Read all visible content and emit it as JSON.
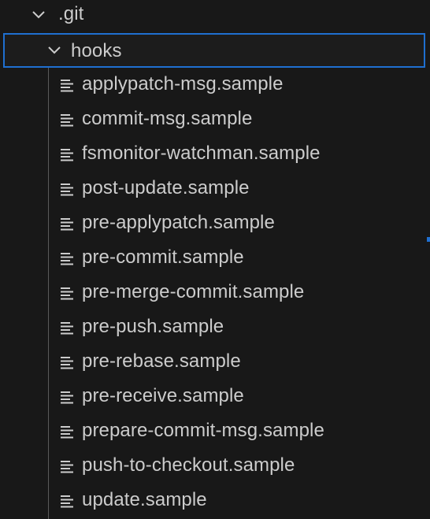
{
  "explorer": {
    "root_folder": {
      "label": ".git",
      "expanded": true
    },
    "sub_folder": {
      "label": "hooks",
      "expanded": true,
      "selected": true
    },
    "files": [
      {
        "label": "applypatch-msg.sample"
      },
      {
        "label": "commit-msg.sample"
      },
      {
        "label": "fsmonitor-watchman.sample"
      },
      {
        "label": "post-update.sample"
      },
      {
        "label": "pre-applypatch.sample"
      },
      {
        "label": "pre-commit.sample"
      },
      {
        "label": "pre-merge-commit.sample"
      },
      {
        "label": "pre-push.sample"
      },
      {
        "label": "pre-rebase.sample"
      },
      {
        "label": "pre-receive.sample"
      },
      {
        "label": "prepare-commit-msg.sample"
      },
      {
        "label": "push-to-checkout.sample"
      },
      {
        "label": "update.sample"
      }
    ],
    "icons": {
      "folder_toggle": "chevron-down-icon",
      "file": "file-lines-icon"
    },
    "colors": {
      "background": "#181818",
      "text": "#cccccc",
      "selection_border": "#1f6fd0",
      "indent_guide": "#5a5a5a"
    }
  }
}
